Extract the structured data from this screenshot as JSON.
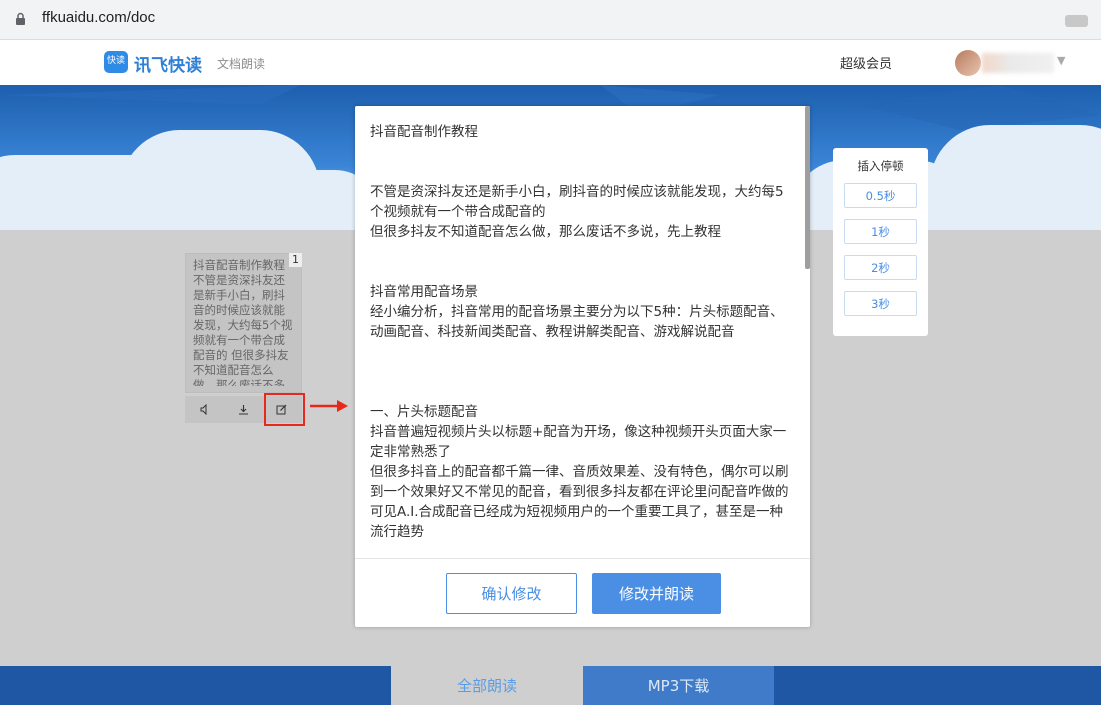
{
  "browser": {
    "url": "ffkuaidu.com/doc"
  },
  "header": {
    "logo_badge": "快读",
    "brand": "讯飞快读",
    "subtitle": "文档朗读",
    "vip_label": "超级会员"
  },
  "thumbnail": {
    "page_number": "1",
    "preview_text": "抖音配音制作教程不管是资深抖友还是新手小白，刷抖音的时候应该就能发现，大约每5个视频就有一个带合成配音的 但很多抖友不知道配音怎么做，那么废话不多说，先上教程",
    "icons": {
      "speaker": "speaker-icon",
      "download": "download-icon",
      "edit": "edit-icon"
    }
  },
  "modal": {
    "paragraphs": [
      "抖音配音制作教程",
      "",
      "",
      "不管是资深抖友还是新手小白，刷抖音的时候应该就能发现，大约每5个视频就有一个带合成配音的",
      "但很多抖友不知道配音怎么做，那么废话不多说，先上教程",
      "",
      "",
      "抖音常用配音场景",
      "经小编分析，抖音常用的配音场景主要分为以下5种：片头标题配音、动画配音、科技新闻类配音、教程讲解类配音、游戏解说配音",
      "",
      "",
      "",
      "一、片头标题配音",
      "抖音普遍短视频片头以标题+配音为开场，像这种视频开头页面大家一定非常熟悉了",
      "但很多抖音上的配音都千篇一律、音质效果差、没有特色，偶尔可以刷到一个效果好又不常见的配音，看到很多抖友都在评论里问配音咋做的",
      "可见A.I.合成配音已经成为短视频用户的一个重要工具了，甚至是一种流行趋势"
    ],
    "confirm_label": "确认修改",
    "read_label": "修改并朗读"
  },
  "pause_panel": {
    "title": "插入停顿",
    "options": [
      "0.5秒",
      "1秒",
      "2秒",
      "3秒"
    ]
  },
  "bottom": {
    "read_all_label": "全部朗读",
    "mp3_label": "MP3下载"
  },
  "colors": {
    "accent": "#4a8fe3",
    "highlight_red": "#e8281d",
    "bottom_bar": "#1f57a4"
  }
}
